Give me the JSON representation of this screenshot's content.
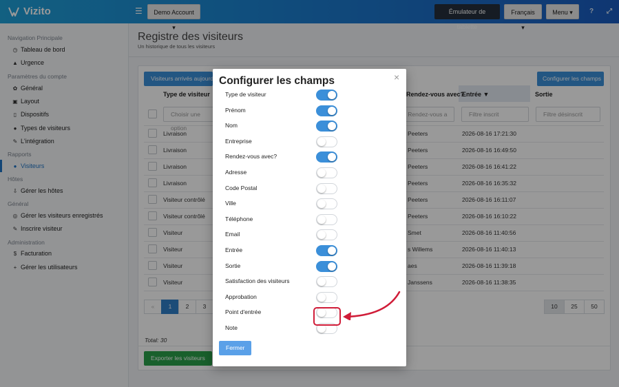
{
  "app": {
    "brand": "Vizito"
  },
  "topbar": {
    "account_label": "Demo Account",
    "tablet_label": "Émulateur de tablette",
    "language_label": "Français",
    "menu_label": "Menu"
  },
  "sidebar": {
    "sections": [
      {
        "title": "Navigation Principale",
        "items": [
          {
            "label": "Tableau de bord",
            "icon": "dashboard-icon"
          },
          {
            "label": "Urgence",
            "icon": "warning-icon"
          }
        ]
      },
      {
        "title": "Paramètres du compte",
        "items": [
          {
            "label": "Général",
            "icon": "gear-icon"
          },
          {
            "label": "Layout",
            "icon": "image-icon"
          },
          {
            "label": "Dispositifs",
            "icon": "tablet-icon"
          },
          {
            "label": "Types de visiteurs",
            "icon": "users-icon"
          },
          {
            "label": "L'intégration",
            "icon": "plug-icon"
          }
        ]
      },
      {
        "title": "Rapports",
        "items": [
          {
            "label": "Visiteurs",
            "icon": "users-icon"
          }
        ]
      },
      {
        "title": "Hôtes",
        "items": [
          {
            "label": "Gérer les hôtes",
            "icon": "download-icon"
          }
        ]
      },
      {
        "title": "Général",
        "items": [
          {
            "label": "Gérer les visiteurs enregistrés",
            "icon": "fingerprint-icon"
          },
          {
            "label": "Inscrire visiteur",
            "icon": "pencil-icon"
          }
        ]
      },
      {
        "title": "Administration",
        "items": [
          {
            "label": "Facturation",
            "icon": "dollar-icon"
          },
          {
            "label": "Gérer les utilisateurs",
            "icon": "user-plus-icon"
          }
        ]
      }
    ]
  },
  "main": {
    "title": "Registre des visiteurs",
    "subtitle": "Un historique de tous les visiteurs",
    "today_button": "Visiteurs arrivés aujourd'hui",
    "configure_button": "Configurer les champs",
    "columns": {
      "type": "Type de visiteur",
      "host": "Rendez-vous avec?",
      "entry": "Entrée",
      "exit": "Sortie"
    },
    "filters": {
      "type": "Choisir une option",
      "host": "Filtre Rendez-vous a",
      "entry": "Filtre inscrit",
      "exit": "Filtre désinscrit"
    },
    "rows": [
      {
        "type": "Livraison",
        "host": "Peeters",
        "entry": "2026-08-16 17:21:30"
      },
      {
        "type": "Livraison",
        "host": "Peeters",
        "entry": "2026-08-16 16:49:50"
      },
      {
        "type": "Livraison",
        "host": "Peeters",
        "entry": "2026-08-16 16:41:22"
      },
      {
        "type": "Livraison",
        "host": "Peeters",
        "entry": "2026-08-16 16:35:32"
      },
      {
        "type": "Visiteur contrôlé",
        "host": "Peeters",
        "entry": "2026-08-16 16:11:07"
      },
      {
        "type": "Visiteur contrôlé",
        "host": "Peeters",
        "entry": "2026-08-16 16:10:22"
      },
      {
        "type": "Visiteur",
        "host": "Smet",
        "entry": "2026-08-16 11:40:56"
      },
      {
        "type": "Visiteur",
        "host": "s Willems",
        "entry": "2026-08-16 11:40:13"
      },
      {
        "type": "Visiteur",
        "host": "aes",
        "entry": "2026-08-16 11:39:18"
      },
      {
        "type": "Visiteur",
        "host": "Janssens",
        "entry": "2026-08-16 11:38:35"
      }
    ],
    "pagination": {
      "prev": "«",
      "pages": [
        "1",
        "2",
        "3"
      ],
      "active": "1"
    },
    "page_sizes": [
      "10",
      "25",
      "50"
    ],
    "selected_page_size": "10",
    "total": "Total: 30",
    "export_button": "Exporter les visiteurs"
  },
  "modal": {
    "title": "Configurer les champs",
    "close_symbol": "×",
    "fields": [
      {
        "label": "Type de visiteur",
        "enabled": true
      },
      {
        "label": "Prénom",
        "enabled": true
      },
      {
        "label": "Nom",
        "enabled": true
      },
      {
        "label": "Entreprise",
        "enabled": false
      },
      {
        "label": "Rendez-vous avec?",
        "enabled": true
      },
      {
        "label": "Adresse",
        "enabled": false
      },
      {
        "label": "Code Postal",
        "enabled": false
      },
      {
        "label": "Ville",
        "enabled": false
      },
      {
        "label": "Téléphone",
        "enabled": false
      },
      {
        "label": "Email",
        "enabled": false
      },
      {
        "label": "Entrée",
        "enabled": true
      },
      {
        "label": "Sortie",
        "enabled": true
      },
      {
        "label": "Satisfaction des visiteurs",
        "enabled": false
      },
      {
        "label": "Approbation",
        "enabled": false
      },
      {
        "label": "Point d'entrée",
        "enabled": false
      },
      {
        "label": "Note",
        "enabled": false
      }
    ],
    "close_button": "Fermer"
  },
  "colors": {
    "primary": "#3b8fd9",
    "accent_red": "#d01c38",
    "success": "#2aa14a"
  }
}
